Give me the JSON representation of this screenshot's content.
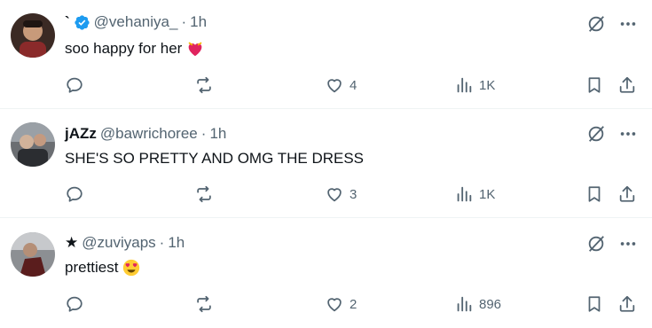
{
  "colors": {
    "icon": "#536471",
    "text": "#0f1419",
    "verified": "#1d9bf0",
    "heart": "#e0245e",
    "separator": "#eff3f4"
  },
  "tweets": [
    {
      "display_name": "`",
      "verified": true,
      "handle": "@vehaniya_",
      "dot": "·",
      "time": "1h",
      "text": "soo happy for her",
      "emoji": "heart-with-ribbon-emoji",
      "replies": "",
      "reposts": "",
      "likes": "4",
      "views": "1K"
    },
    {
      "display_name": "jAZz",
      "verified": false,
      "handle": "@bawrichoree",
      "dot": "·",
      "time": "1h",
      "text": "SHE'S SO PRETTY AND OMG THE DRESS",
      "emoji": "",
      "replies": "",
      "reposts": "",
      "likes": "3",
      "views": "1K"
    },
    {
      "display_name": "★",
      "verified": false,
      "handle": "@zuviyaps",
      "dot": "·",
      "time": "1h",
      "text": "prettiest",
      "emoji": "heart-eyes-emoji",
      "replies": "",
      "reposts": "",
      "likes": "2",
      "views": "896"
    }
  ]
}
